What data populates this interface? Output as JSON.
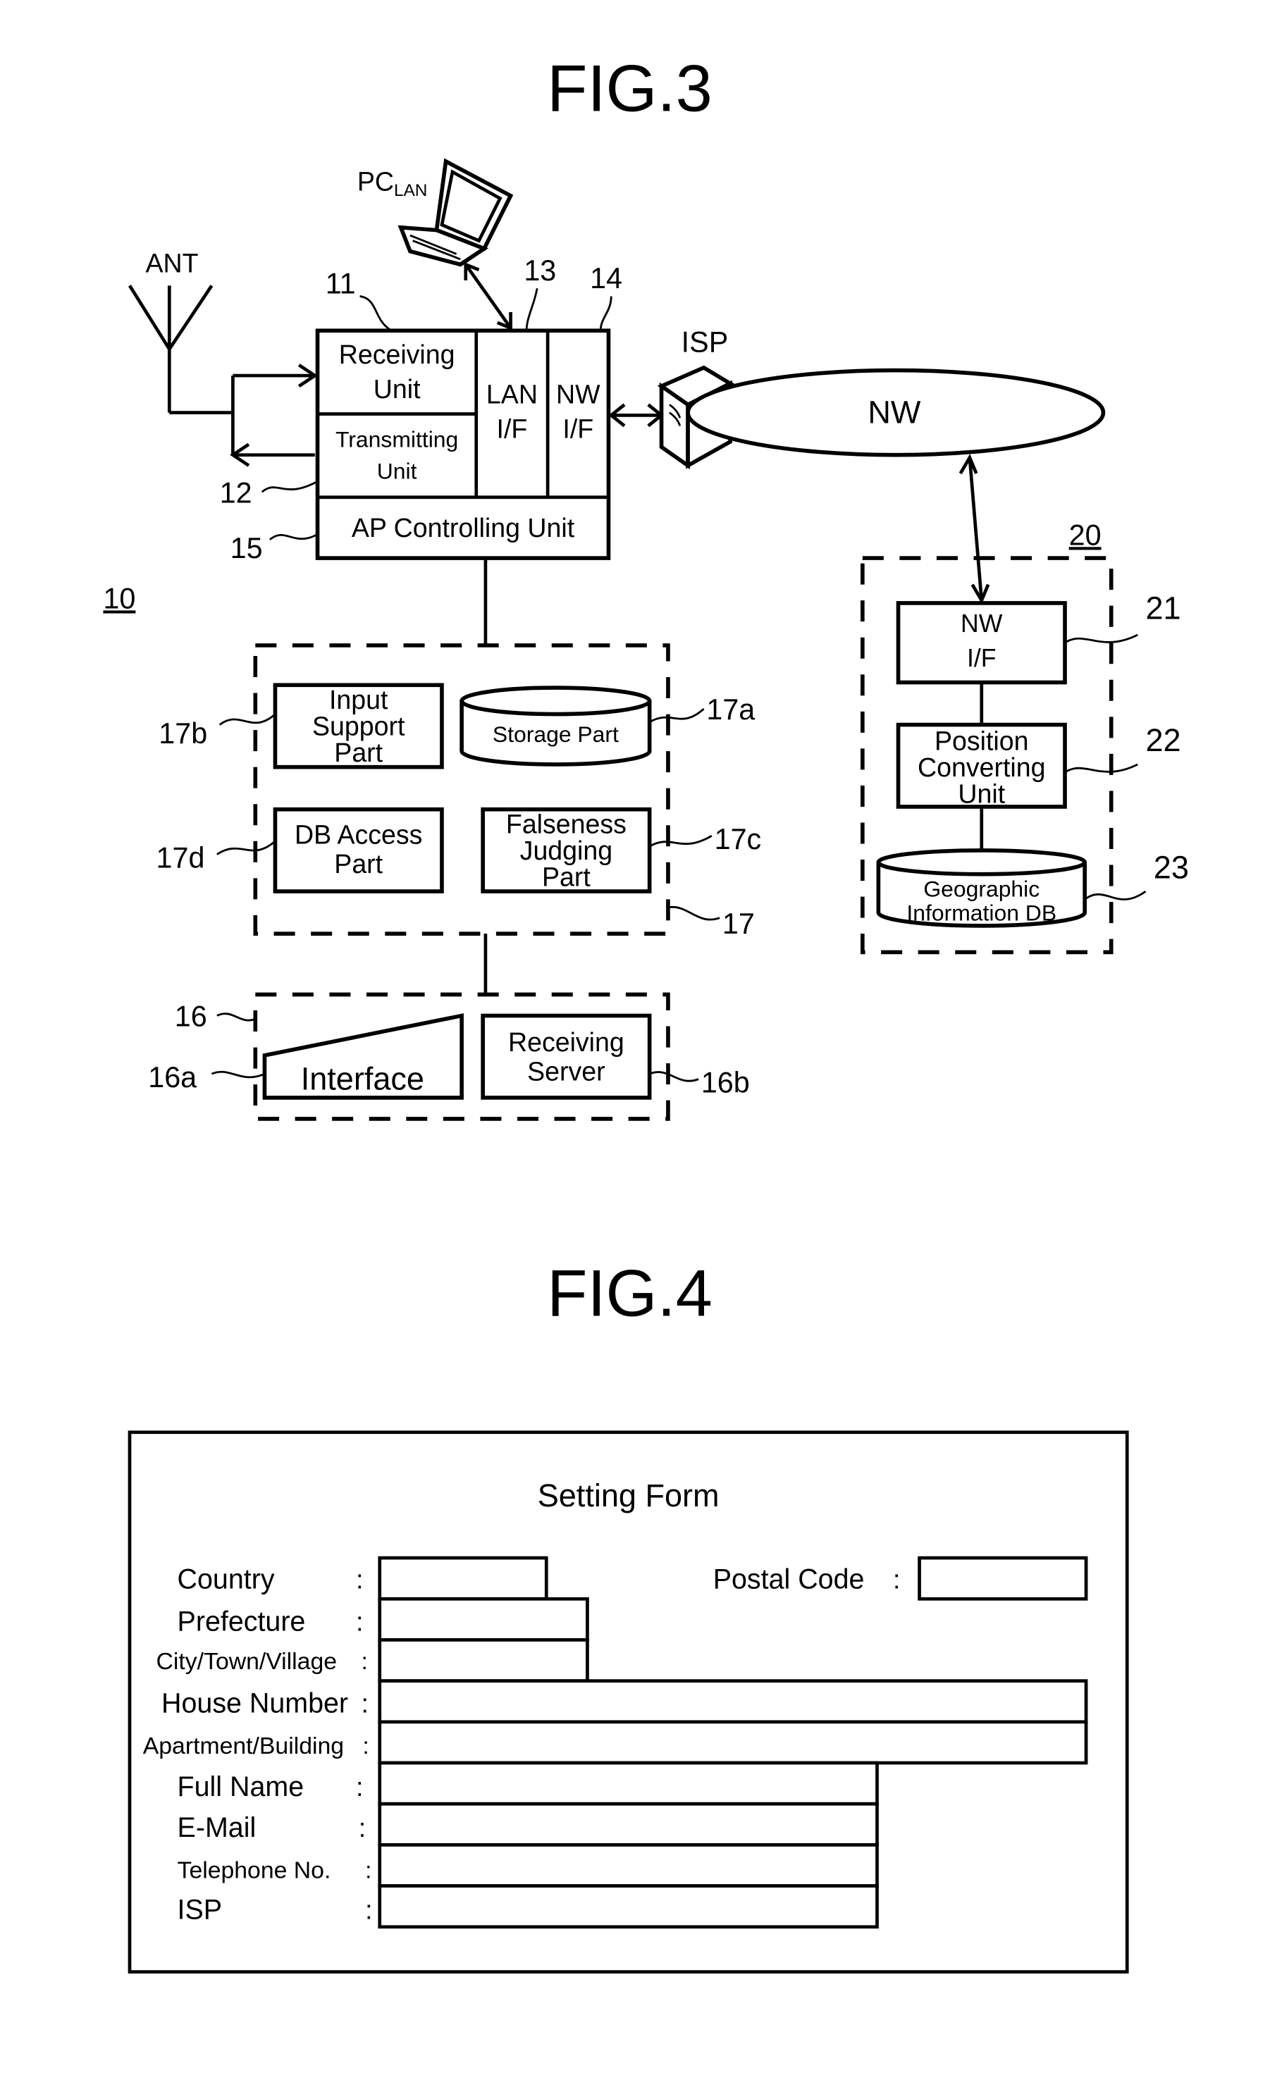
{
  "fig3": {
    "title": "FIG.3",
    "pc_label": "PC",
    "pc_sub": "LAN",
    "ant_label": "ANT",
    "isp_label": "ISP",
    "nw_label": "NW",
    "ref_10": "10",
    "ref_11": "11",
    "ref_12": "12",
    "ref_13": "13",
    "ref_14": "14",
    "ref_15": "15",
    "ref_16": "16",
    "ref_16a": "16a",
    "ref_16b": "16b",
    "ref_17": "17",
    "ref_17a": "17a",
    "ref_17b": "17b",
    "ref_17c": "17c",
    "ref_17d": "17d",
    "ref_20": "20",
    "ref_21": "21",
    "ref_22": "22",
    "ref_23": "23",
    "receiving_unit": [
      "Receiving",
      "Unit"
    ],
    "transmitting_unit": [
      "Transmitting",
      "Unit"
    ],
    "lan_if": [
      "LAN",
      "I/F"
    ],
    "nw_if": [
      "NW",
      "I/F"
    ],
    "ap_controlling_unit": "AP Controlling Unit",
    "input_support_part": [
      "Input",
      "Support",
      "Part"
    ],
    "storage_part": "Storage Part",
    "db_access_part": [
      "DB Access",
      "Part"
    ],
    "falseness_judging_part": [
      "Falseness",
      "Judging",
      "Part"
    ],
    "interface": "Interface",
    "receiving_server": [
      "Receiving",
      "Server"
    ],
    "server_nw_if": [
      "NW",
      "I/F"
    ],
    "position_converting_unit": [
      "Position",
      "Converting",
      "Unit"
    ],
    "geographic_db": [
      "Geographic",
      "Information DB"
    ]
  },
  "fig4": {
    "title": "FIG.4",
    "form_title": "Setting Form",
    "fields": {
      "country": "Country",
      "postal_code": "Postal Code",
      "prefecture": "Prefecture",
      "city": "City/Town/Village",
      "house_number": "House Number",
      "apartment": "Apartment/Building",
      "full_name": "Full Name",
      "email": "E-Mail",
      "telephone": "Telephone No.",
      "isp": "ISP"
    },
    "colon": ":"
  }
}
